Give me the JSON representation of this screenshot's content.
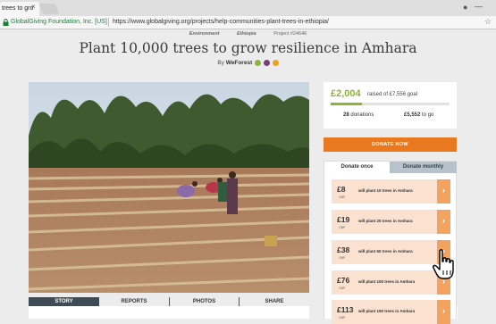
{
  "browser": {
    "tab_title": "trees to gro",
    "tab_close": "×",
    "account_glyph": "●",
    "window_min": "—",
    "secure_label": "GlobalGiving Foundation, Inc. [US]",
    "url": "https://www.globalgiving.org/projects/help-communities-plant-trees-in-ethiopia/",
    "bookmark_glyph": "☆"
  },
  "breadcrumb": {
    "category": "Environment",
    "country": "Ethiopia",
    "project_id": "Project #24646"
  },
  "project": {
    "title": "Plant 10,000 trees to grow resilience in Amhara",
    "by_label": "By",
    "organization": "WeForest"
  },
  "photo_tabs": [
    "STORY",
    "REPORTS",
    "PHOTOS",
    "SHARE"
  ],
  "progress": {
    "raised": "£2,004",
    "raised_suffix": "raised of £7,556 goal",
    "fraction": 0.265,
    "donations_count": "28",
    "donations_label": "donations",
    "to_go_amount": "£5,552",
    "to_go_label": "to go"
  },
  "donate_now_label": "DONATE NOW",
  "donate_tabs": {
    "once": "Donate once",
    "monthly": "Donate monthly"
  },
  "donation_options": [
    {
      "amount": "£8",
      "currency": "GBP",
      "desc": "will plant 10 trees in Amhara",
      "arrow": "›"
    },
    {
      "amount": "£19",
      "currency": "GBP",
      "desc": "will plant 25 trees in Amhara",
      "arrow": "›"
    },
    {
      "amount": "£38",
      "currency": "GBP",
      "desc": "will plant 50 trees in Amhara",
      "arrow": "›"
    },
    {
      "amount": "£76",
      "currency": "GBP",
      "desc": "will plant 100 trees in Amhara",
      "arrow": "›"
    },
    {
      "amount": "£113",
      "currency": "GBP",
      "desc": "will plant 150 trees in Amhara",
      "arrow": "›"
    }
  ],
  "colors": {
    "accent_green": "#8cb33b",
    "donate_orange": "#e9781f",
    "option_bg": "#fbe1cf",
    "option_arrow": "#f4a25f",
    "nav_dark": "#3e4a54"
  }
}
